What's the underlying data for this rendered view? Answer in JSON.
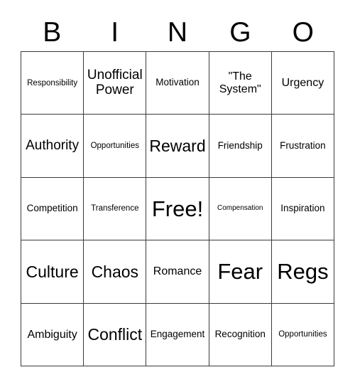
{
  "card": {
    "title": "BINGO",
    "header_letters": [
      "B",
      "I",
      "N",
      "G",
      "O"
    ],
    "free_space": "Free!",
    "border_color": "#3a3a3a",
    "text_color": "#000000",
    "background_color": "#ffffff",
    "rows": [
      [
        {
          "label": "Responsibility",
          "size": "sm"
        },
        {
          "label": "Unofficial Power",
          "size": "xl"
        },
        {
          "label": "Motivation",
          "size": "md"
        },
        {
          "label": "\"The System\"",
          "size": "lg"
        },
        {
          "label": "Urgency",
          "size": "lg"
        }
      ],
      [
        {
          "label": "Authority",
          "size": "xl"
        },
        {
          "label": "Opportunities",
          "size": "sm"
        },
        {
          "label": "Reward",
          "size": "xxl"
        },
        {
          "label": "Friendship",
          "size": "md"
        },
        {
          "label": "Frustration",
          "size": "md"
        }
      ],
      [
        {
          "label": "Competition",
          "size": "md"
        },
        {
          "label": "Transference",
          "size": "sm"
        },
        {
          "label": "Free!",
          "size": "huge"
        },
        {
          "label": "Compensation",
          "size": "xs"
        },
        {
          "label": "Inspiration",
          "size": "md"
        }
      ],
      [
        {
          "label": "Culture",
          "size": "xxl"
        },
        {
          "label": "Chaos",
          "size": "xxl"
        },
        {
          "label": "Romance",
          "size": "lg"
        },
        {
          "label": "Fear",
          "size": "huge"
        },
        {
          "label": "Regs",
          "size": "huge"
        }
      ],
      [
        {
          "label": "Ambiguity",
          "size": "lg"
        },
        {
          "label": "Conflict",
          "size": "xxl"
        },
        {
          "label": "Engagement",
          "size": "md"
        },
        {
          "label": "Recognition",
          "size": "md"
        },
        {
          "label": "Opportunities",
          "size": "sm"
        }
      ]
    ]
  }
}
